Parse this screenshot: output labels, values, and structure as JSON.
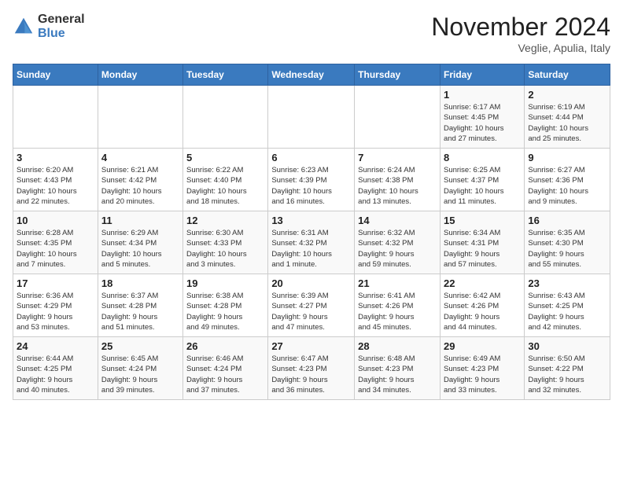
{
  "logo": {
    "general": "General",
    "blue": "Blue"
  },
  "header": {
    "month": "November 2024",
    "location": "Veglie, Apulia, Italy"
  },
  "days_of_week": [
    "Sunday",
    "Monday",
    "Tuesday",
    "Wednesday",
    "Thursday",
    "Friday",
    "Saturday"
  ],
  "weeks": [
    [
      {
        "day": "",
        "info": ""
      },
      {
        "day": "",
        "info": ""
      },
      {
        "day": "",
        "info": ""
      },
      {
        "day": "",
        "info": ""
      },
      {
        "day": "",
        "info": ""
      },
      {
        "day": "1",
        "info": "Sunrise: 6:17 AM\nSunset: 4:45 PM\nDaylight: 10 hours\nand 27 minutes."
      },
      {
        "day": "2",
        "info": "Sunrise: 6:19 AM\nSunset: 4:44 PM\nDaylight: 10 hours\nand 25 minutes."
      }
    ],
    [
      {
        "day": "3",
        "info": "Sunrise: 6:20 AM\nSunset: 4:43 PM\nDaylight: 10 hours\nand 22 minutes."
      },
      {
        "day": "4",
        "info": "Sunrise: 6:21 AM\nSunset: 4:42 PM\nDaylight: 10 hours\nand 20 minutes."
      },
      {
        "day": "5",
        "info": "Sunrise: 6:22 AM\nSunset: 4:40 PM\nDaylight: 10 hours\nand 18 minutes."
      },
      {
        "day": "6",
        "info": "Sunrise: 6:23 AM\nSunset: 4:39 PM\nDaylight: 10 hours\nand 16 minutes."
      },
      {
        "day": "7",
        "info": "Sunrise: 6:24 AM\nSunset: 4:38 PM\nDaylight: 10 hours\nand 13 minutes."
      },
      {
        "day": "8",
        "info": "Sunrise: 6:25 AM\nSunset: 4:37 PM\nDaylight: 10 hours\nand 11 minutes."
      },
      {
        "day": "9",
        "info": "Sunrise: 6:27 AM\nSunset: 4:36 PM\nDaylight: 10 hours\nand 9 minutes."
      }
    ],
    [
      {
        "day": "10",
        "info": "Sunrise: 6:28 AM\nSunset: 4:35 PM\nDaylight: 10 hours\nand 7 minutes."
      },
      {
        "day": "11",
        "info": "Sunrise: 6:29 AM\nSunset: 4:34 PM\nDaylight: 10 hours\nand 5 minutes."
      },
      {
        "day": "12",
        "info": "Sunrise: 6:30 AM\nSunset: 4:33 PM\nDaylight: 10 hours\nand 3 minutes."
      },
      {
        "day": "13",
        "info": "Sunrise: 6:31 AM\nSunset: 4:32 PM\nDaylight: 10 hours\nand 1 minute."
      },
      {
        "day": "14",
        "info": "Sunrise: 6:32 AM\nSunset: 4:32 PM\nDaylight: 9 hours\nand 59 minutes."
      },
      {
        "day": "15",
        "info": "Sunrise: 6:34 AM\nSunset: 4:31 PM\nDaylight: 9 hours\nand 57 minutes."
      },
      {
        "day": "16",
        "info": "Sunrise: 6:35 AM\nSunset: 4:30 PM\nDaylight: 9 hours\nand 55 minutes."
      }
    ],
    [
      {
        "day": "17",
        "info": "Sunrise: 6:36 AM\nSunset: 4:29 PM\nDaylight: 9 hours\nand 53 minutes."
      },
      {
        "day": "18",
        "info": "Sunrise: 6:37 AM\nSunset: 4:28 PM\nDaylight: 9 hours\nand 51 minutes."
      },
      {
        "day": "19",
        "info": "Sunrise: 6:38 AM\nSunset: 4:28 PM\nDaylight: 9 hours\nand 49 minutes."
      },
      {
        "day": "20",
        "info": "Sunrise: 6:39 AM\nSunset: 4:27 PM\nDaylight: 9 hours\nand 47 minutes."
      },
      {
        "day": "21",
        "info": "Sunrise: 6:41 AM\nSunset: 4:26 PM\nDaylight: 9 hours\nand 45 minutes."
      },
      {
        "day": "22",
        "info": "Sunrise: 6:42 AM\nSunset: 4:26 PM\nDaylight: 9 hours\nand 44 minutes."
      },
      {
        "day": "23",
        "info": "Sunrise: 6:43 AM\nSunset: 4:25 PM\nDaylight: 9 hours\nand 42 minutes."
      }
    ],
    [
      {
        "day": "24",
        "info": "Sunrise: 6:44 AM\nSunset: 4:25 PM\nDaylight: 9 hours\nand 40 minutes."
      },
      {
        "day": "25",
        "info": "Sunrise: 6:45 AM\nSunset: 4:24 PM\nDaylight: 9 hours\nand 39 minutes."
      },
      {
        "day": "26",
        "info": "Sunrise: 6:46 AM\nSunset: 4:24 PM\nDaylight: 9 hours\nand 37 minutes."
      },
      {
        "day": "27",
        "info": "Sunrise: 6:47 AM\nSunset: 4:23 PM\nDaylight: 9 hours\nand 36 minutes."
      },
      {
        "day": "28",
        "info": "Sunrise: 6:48 AM\nSunset: 4:23 PM\nDaylight: 9 hours\nand 34 minutes."
      },
      {
        "day": "29",
        "info": "Sunrise: 6:49 AM\nSunset: 4:23 PM\nDaylight: 9 hours\nand 33 minutes."
      },
      {
        "day": "30",
        "info": "Sunrise: 6:50 AM\nSunset: 4:22 PM\nDaylight: 9 hours\nand 32 minutes."
      }
    ]
  ]
}
